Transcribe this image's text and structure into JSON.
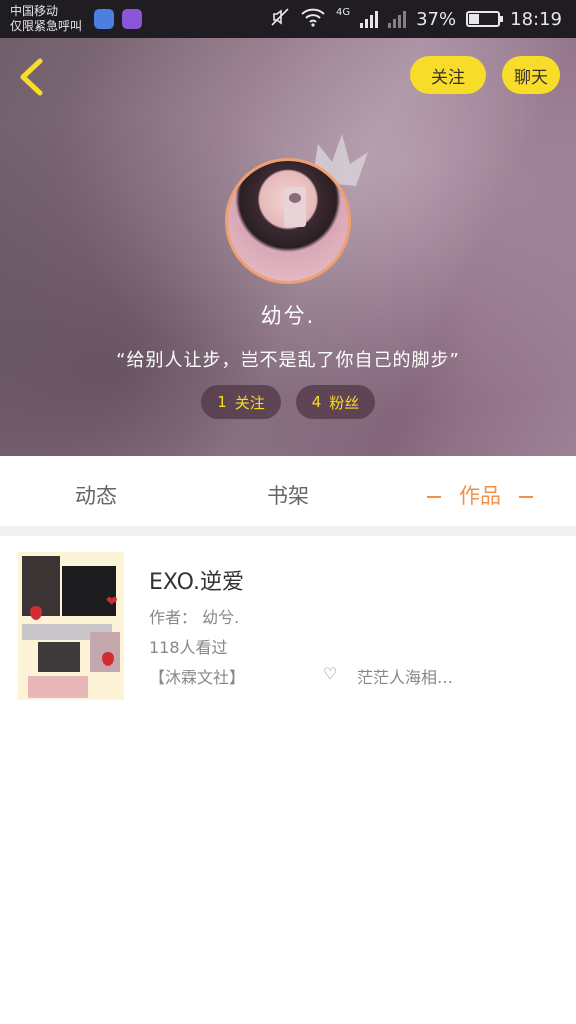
{
  "status_bar": {
    "carrier_line1": "中国移动",
    "carrier_line2": "仅限紧急呼叫",
    "network": "4G",
    "battery_text": "37%",
    "battery_level": 0.37,
    "time": "18:19"
  },
  "header": {
    "follow_label": "关注",
    "chat_label": "聊天"
  },
  "profile": {
    "username": "幼兮.",
    "signature": "“给别人让步，岂不是乱了你自己的脚步”",
    "following_count": "1",
    "following_label": "关注",
    "fans_count": "4",
    "fans_label": "粉丝"
  },
  "tabs": [
    {
      "label": "动态"
    },
    {
      "label": "书架"
    },
    {
      "label": "作品",
      "active": true
    }
  ],
  "works": [
    {
      "title": "EXO.逆爱",
      "author_label": "作者： 幼兮.",
      "views": "118人看过",
      "tag1": "【沐霖文社】",
      "tag2": "茫茫人海相…"
    }
  ],
  "colors": {
    "accent_orange": "#f2924a",
    "button_yellow": "#f7dc2a"
  }
}
